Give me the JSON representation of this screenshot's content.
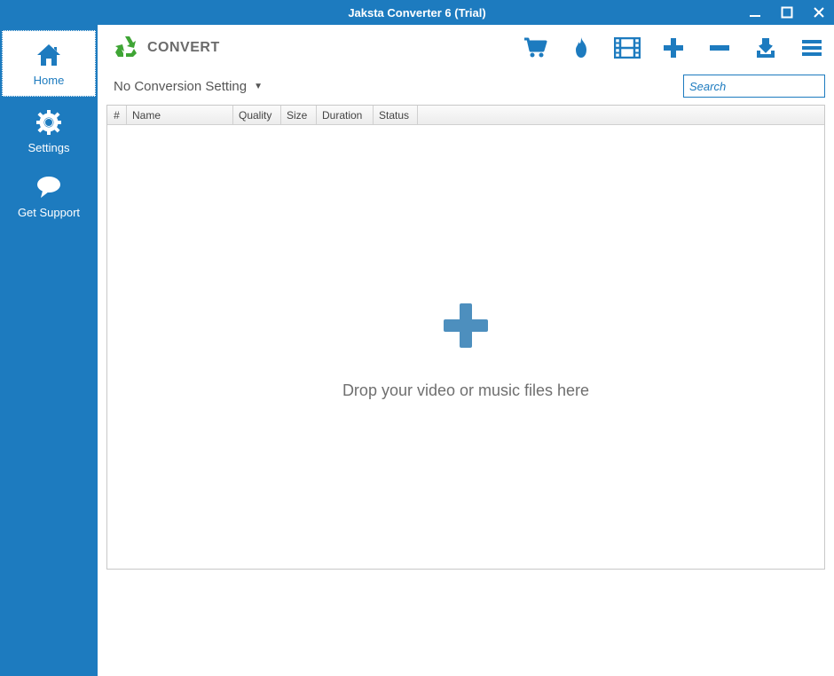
{
  "window": {
    "title": "Jaksta Converter 6 (Trial)"
  },
  "colors": {
    "primary": "#1d7bbf",
    "accent_green": "#3fa535",
    "muted_blue": "#4d8fbe"
  },
  "sidebar": {
    "items": [
      {
        "label": "Home",
        "icon": "home-icon",
        "active": true
      },
      {
        "label": "Settings",
        "icon": "gear-icon",
        "active": false
      },
      {
        "label": "Get Support",
        "icon": "speech-icon",
        "active": false
      }
    ]
  },
  "header": {
    "title": "CONVERT"
  },
  "toolbar": {
    "icons": [
      "cart-icon",
      "flame-icon",
      "film-icon",
      "plus-icon",
      "minus-icon",
      "download-icon",
      "menu-icon"
    ]
  },
  "conversion": {
    "dropdown_label": "No Conversion Setting"
  },
  "search": {
    "placeholder": "Search"
  },
  "table": {
    "columns": [
      "#",
      "Name",
      "Quality",
      "Size",
      "Duration",
      "Status"
    ],
    "rows": []
  },
  "dropzone": {
    "hint": "Drop your video or music files here"
  }
}
